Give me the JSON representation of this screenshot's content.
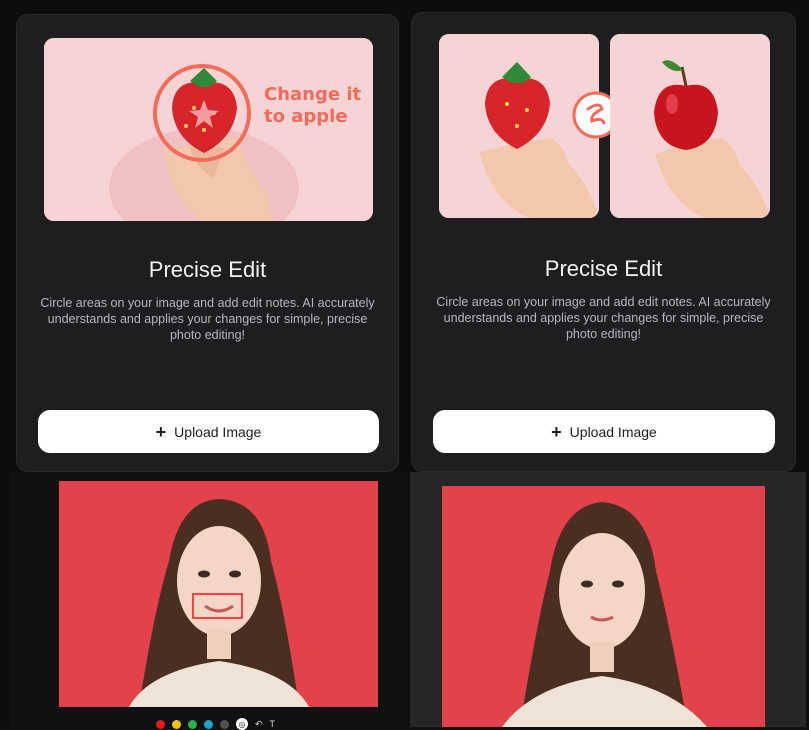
{
  "cards": [
    {
      "overlay_text": "Change it\nto apple",
      "title": "Precise Edit",
      "description": "Circle areas on your image and add edit notes. AI accurately understands and applies your changes for simple, precise photo editing!",
      "upload_label": "Upload Image"
    },
    {
      "title": "Precise Edit",
      "description": "Circle areas on your image and add edit notes. AI accurately understands and applies your changes for simple, precise photo editing!",
      "upload_label": "Upload Image"
    }
  ],
  "toolbar": {
    "colors": [
      "#e8191f",
      "#f2c015",
      "#26b24a",
      "#19a6c9",
      "#505050"
    ],
    "tools": [
      "undo-icon",
      "pointer-icon",
      "text-icon"
    ],
    "tool_labels": [
      "↶",
      "T"
    ]
  },
  "accent": {
    "card_bg": "#1e1e20",
    "button_bg": "#ffffff",
    "brand_pink": "#f36b59",
    "portrait_red": "#e04049"
  }
}
